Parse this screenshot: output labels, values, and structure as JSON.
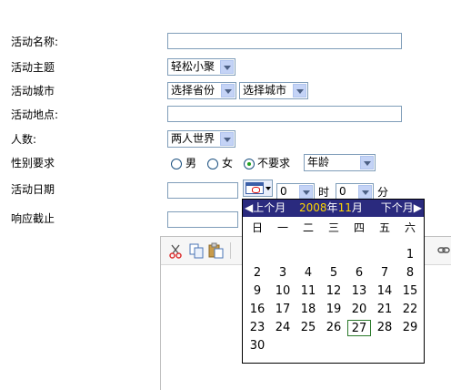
{
  "form": {
    "name_label": "活动名称:",
    "theme_label": "活动主题",
    "theme_value": "轻松小聚",
    "city_label": "活动城市",
    "province_value": "选择省份",
    "city_value": "选择城市",
    "place_label": "活动地点:",
    "people_label": "人数:",
    "people_value": "两人世界",
    "gender_label": "性别要求",
    "gender_options": [
      "男",
      "女",
      "不要求"
    ],
    "gender_selected": "不要求",
    "age_value": "年龄",
    "date_label": "活动日期",
    "hour_value": "0",
    "hour_unit": "时",
    "minute_value": "0",
    "minute_unit": "分",
    "deadline_label": "响应截止"
  },
  "calendar": {
    "prev": "◀上个月",
    "next": "下个月▶",
    "year": "2008",
    "year_unit": "年",
    "month": "11",
    "month_unit": "月",
    "weekdays": [
      "日",
      "一",
      "二",
      "三",
      "四",
      "五",
      "六"
    ],
    "days": [
      "1",
      "2",
      "3",
      "4",
      "5",
      "6",
      "7",
      "8",
      "9",
      "10",
      "11",
      "12",
      "13",
      "14",
      "15",
      "16",
      "17",
      "18",
      "19",
      "20",
      "21",
      "22",
      "23",
      "24",
      "25",
      "26",
      "27",
      "28",
      "29",
      "30"
    ],
    "today": "27"
  },
  "editor": {
    "toolbar_icons": [
      "cut-icon",
      "copy-icon",
      "paste-icon",
      "link-icon"
    ]
  },
  "colors": {
    "calendar_header": "#2a2a7e",
    "calendar_header_month": "#ffd700",
    "today_border": "#2a7a2a",
    "input_border": "#7f9db9"
  }
}
